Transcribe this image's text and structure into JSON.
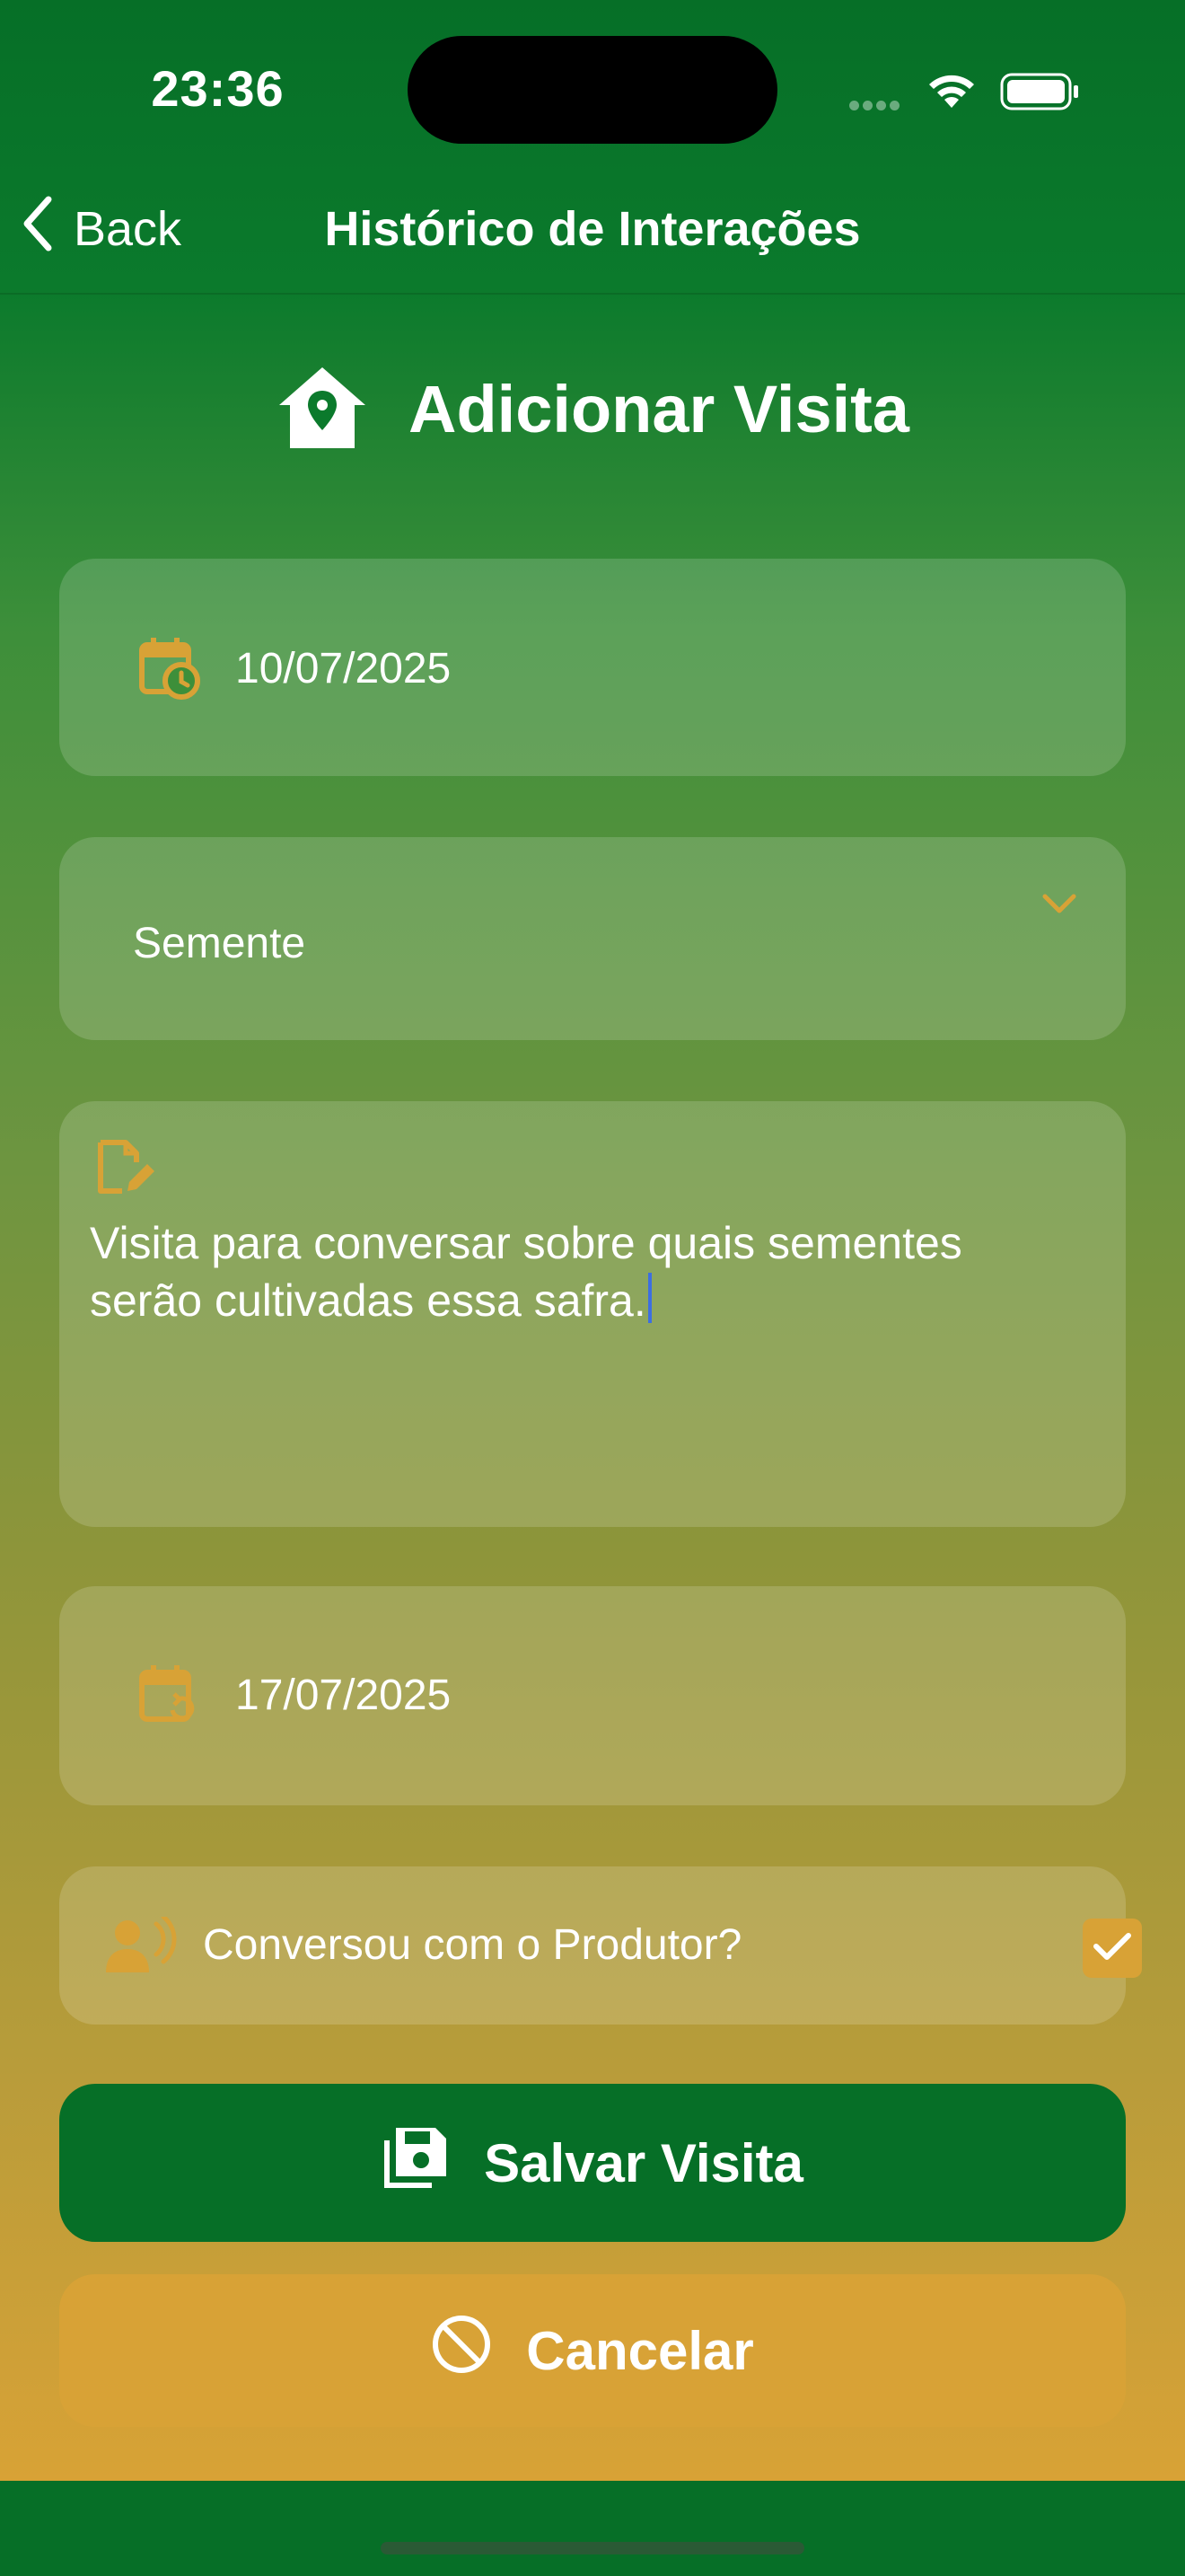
{
  "status_bar": {
    "time": "23:36"
  },
  "nav": {
    "back_label": "Back",
    "title": "Histórico de Interações"
  },
  "page": {
    "title": "Adicionar Visita"
  },
  "form": {
    "visit_date": "10/07/2025",
    "type_selected": "Semente",
    "notes": "Visita para conversar sobre quais sementes serão cultivadas essa safra.",
    "next_date": "17/07/2025",
    "talked_label": "Conversou com o Produtor?",
    "talked_checked": true
  },
  "actions": {
    "save_label": "Salvar Visita",
    "cancel_label": "Cancelar"
  },
  "colors": {
    "primary_green": "#066F27",
    "accent_orange": "#D8A236",
    "text": "#FFFFFF"
  },
  "icons": {
    "date": "calendar-clock-icon",
    "type": "chevron-down-icon",
    "notes": "edit-note-icon",
    "next_date": "calendar-refresh-icon",
    "talked": "person-speaking-icon",
    "save": "save-icon",
    "cancel": "block-icon",
    "heading": "home-location-icon"
  }
}
